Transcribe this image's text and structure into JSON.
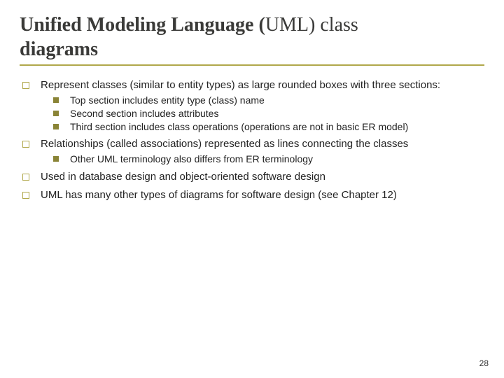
{
  "title_main": "Unified Modeling Language (",
  "title_paren": "UML) class",
  "title_line2": "diagrams",
  "bullets": [
    {
      "text": "Represent classes (similar to entity types) as large rounded boxes with three sections:",
      "sub": [
        "Top section includes entity type (class) name",
        "Second section includes attributes",
        "Third section includes class operations (operations are not in basic ER model)"
      ]
    },
    {
      "text": "Relationships (called associations) represented as lines connecting the classes",
      "sub": [
        "Other UML terminology also differs from ER terminology"
      ]
    },
    {
      "text": "Used in database design and object-oriented software design",
      "sub": []
    },
    {
      "text": "UML has many other types of diagrams for software design (see Chapter 12)",
      "sub": []
    }
  ],
  "page_number": "28"
}
